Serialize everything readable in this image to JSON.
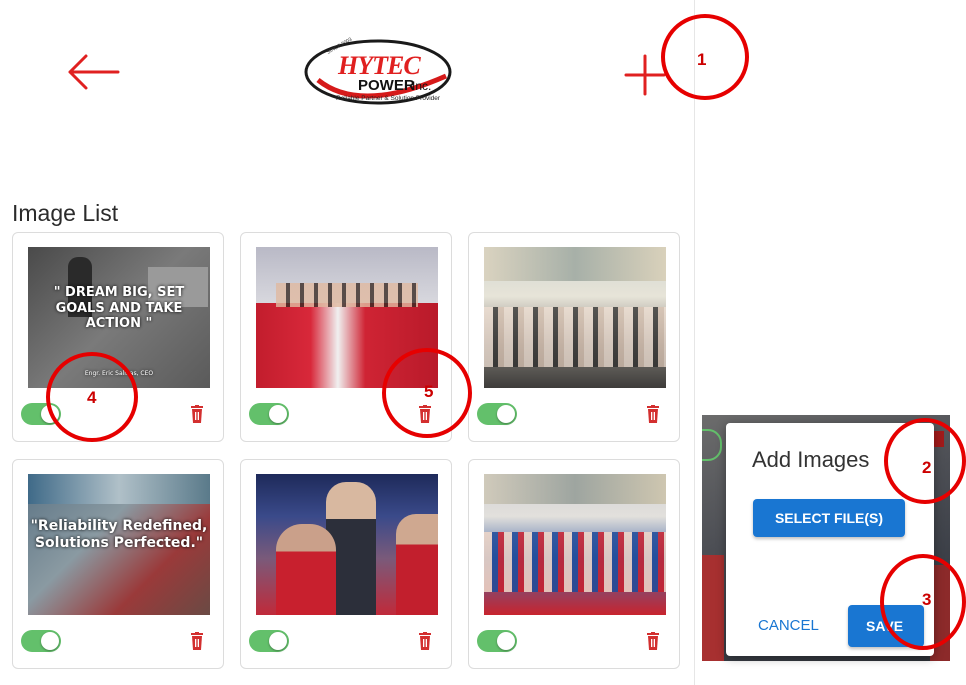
{
  "header": {
    "back_icon": "arrow-left-icon",
    "add_icon": "plus-icon",
    "logo": {
      "brand": "HYTEC",
      "sub": "POWER Inc.",
      "tagline": "Reliable Partner & Solution Provider",
      "since": "SINCE 2003"
    }
  },
  "image_list": {
    "title": "Image List",
    "cards": [
      {
        "caption": "\" DREAM BIG, SET GOALS AND TAKE ACTION \"",
        "credit": "Engr. Eric Salinas, CEO",
        "enabled": true
      },
      {
        "caption": "",
        "credit": "",
        "enabled": true
      },
      {
        "caption": "",
        "credit": "",
        "enabled": true
      },
      {
        "caption": "\"Reliability Redefined, Solutions Perfected.\"",
        "credit": "",
        "enabled": true
      },
      {
        "caption": "",
        "credit": "",
        "enabled": true
      },
      {
        "caption": "",
        "credit": "",
        "enabled": true
      }
    ]
  },
  "dialog": {
    "title": "Add Images",
    "select_label": "SELECT FILE(S)",
    "cancel_label": "CANCEL",
    "save_label": "SAVE"
  },
  "annotations": [
    "1",
    "2",
    "3",
    "4",
    "5"
  ],
  "colors": {
    "accent_red": "#e02020",
    "primary_blue": "#1976d2",
    "toggle_green": "#63c06b",
    "annotation_red": "#e60000"
  }
}
